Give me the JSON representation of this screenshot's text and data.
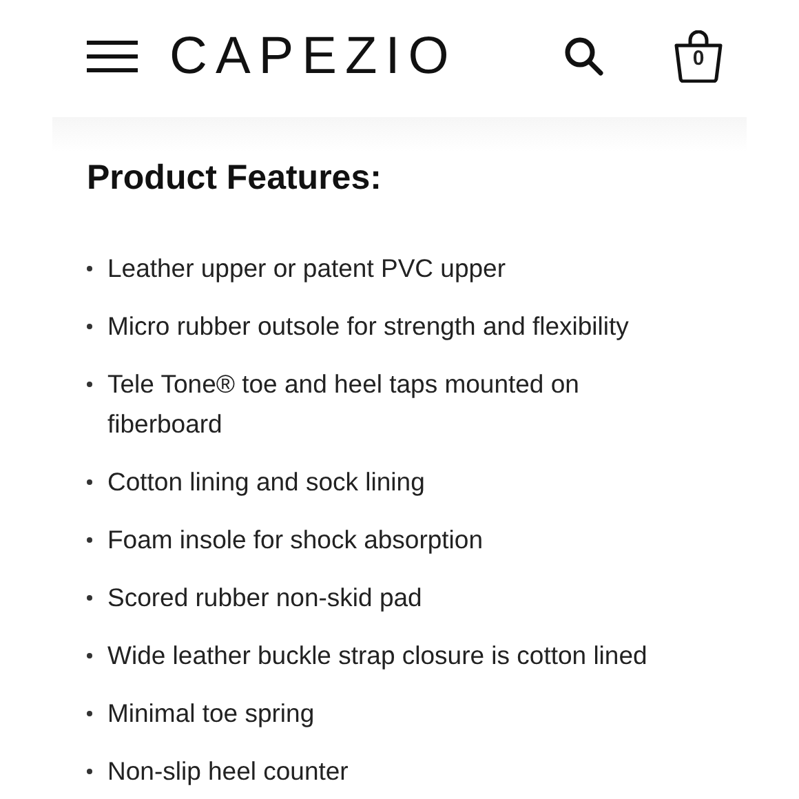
{
  "header": {
    "logo": "CAPEZIO",
    "cart_count": "0"
  },
  "section": {
    "title": "Product Features:",
    "features": [
      "Leather upper or patent PVC upper",
      "Micro rubber outsole for strength and flexibility",
      "Tele Tone® toe and heel taps mounted on fiberboard",
      "Cotton lining and sock lining",
      "Foam insole for shock absorption",
      "Scored rubber non-skid pad",
      "Wide leather buckle strap closure is cotton lined",
      "Minimal toe spring",
      "Non-slip heel counter"
    ]
  }
}
